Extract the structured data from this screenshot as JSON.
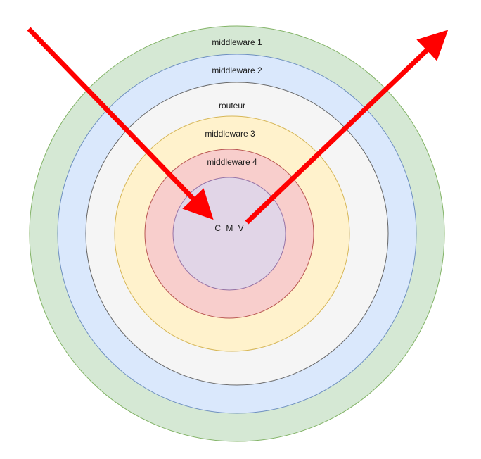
{
  "diagram": {
    "rings": [
      {
        "label": "middleware 1",
        "fill": "#d5e8d4",
        "stroke": "#82b366"
      },
      {
        "label": "middleware 2",
        "fill": "#dae8fc",
        "stroke": "#6c8ebf"
      },
      {
        "label": "routeur",
        "fill": "#f5f5f5",
        "stroke": "#666666"
      },
      {
        "label": "middleware 3",
        "fill": "#fff2cc",
        "stroke": "#d6b656"
      },
      {
        "label": "middleware 4",
        "fill": "#f8cecc",
        "stroke": "#b85450"
      },
      {
        "label": "C M V",
        "fill": "#e1d5e7",
        "stroke": "#9673a6"
      }
    ],
    "arrows": [
      {
        "direction": "in",
        "color": "#ff0000"
      },
      {
        "direction": "out",
        "color": "#ff0000"
      }
    ]
  }
}
